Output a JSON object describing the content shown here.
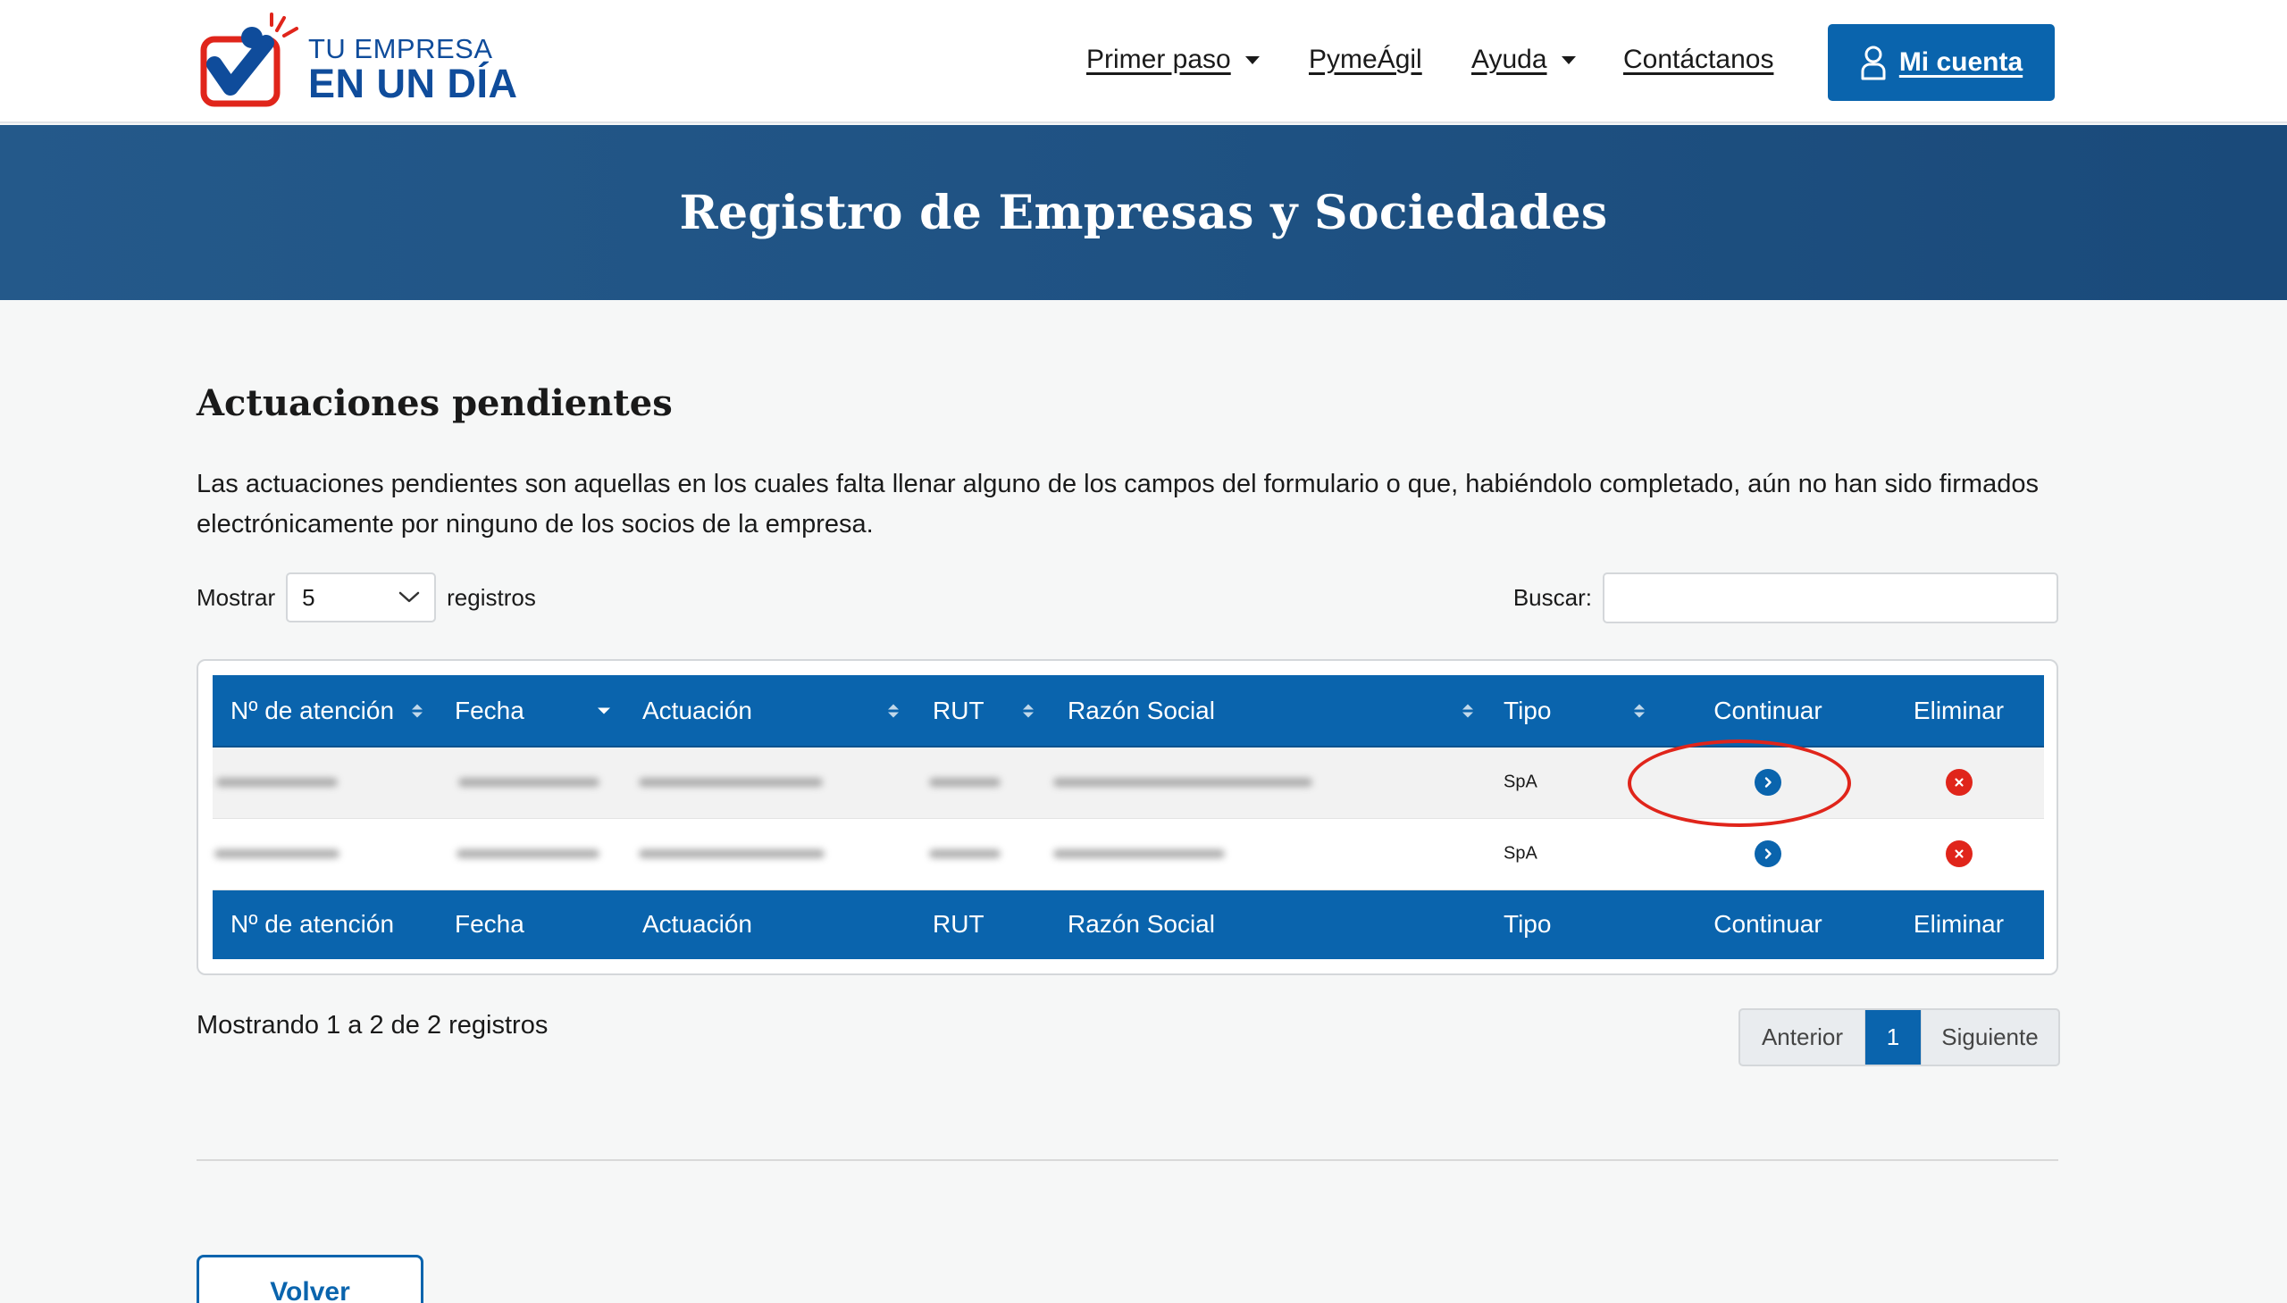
{
  "header": {
    "logo_line1": "TU EMPRESA",
    "logo_line2": "EN UN DÍA",
    "nav": [
      {
        "label": "Primer paso",
        "dropdown": true
      },
      {
        "label": "PymeÁgil",
        "dropdown": false
      },
      {
        "label": "Ayuda",
        "dropdown": true
      },
      {
        "label": "Contáctanos",
        "dropdown": false
      }
    ],
    "account_label": "Mi cuenta"
  },
  "banner": {
    "title": "Registro de Empresas y Sociedades"
  },
  "main": {
    "title": "Actuaciones pendientes",
    "description": "Las actuaciones pendientes son aquellas en los cuales falta llenar alguno de los campos del formulario o que, habiéndolo completado, aún no han sido firmados electrónicamente por ninguno de los socios de la empresa."
  },
  "controls": {
    "show_label": "Mostrar",
    "page_size": "5",
    "records_label": "registros",
    "search_label": "Buscar:",
    "search_value": ""
  },
  "table": {
    "columns": [
      "Nº de atención",
      "Fecha",
      "Actuación",
      "RUT",
      "Razón Social",
      "Tipo",
      "Continuar",
      "Eliminar"
    ],
    "rows": [
      {
        "tipo": "SpA"
      },
      {
        "tipo": "SpA"
      }
    ]
  },
  "info": "Mostrando 1 a 2 de 2 registros",
  "pagination": {
    "previous": "Anterior",
    "current": "1",
    "next": "Siguiente"
  },
  "back_label": "Volver",
  "colors": {
    "primary": "#0a64ad",
    "banner": "#1f5283",
    "danger": "#e0251b",
    "logo_blue": "#0f4c9b",
    "logo_red": "#e0251b"
  }
}
